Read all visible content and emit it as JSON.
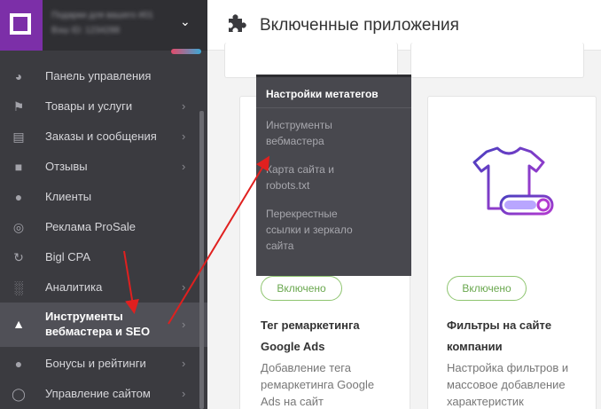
{
  "account": {
    "line1": "Подарки для вашего #01",
    "line2": "Вэш ID: 1234288"
  },
  "sidebar": {
    "items": [
      {
        "icon": "gauge-icon",
        "label": "Панель управления",
        "has_submenu": false
      },
      {
        "icon": "tag-icon",
        "label": "Товары и услуги",
        "has_submenu": true
      },
      {
        "icon": "cart-icon",
        "label": "Заказы и сообщения",
        "has_submenu": true
      },
      {
        "icon": "comment-icon",
        "label": "Отзывы",
        "has_submenu": true
      },
      {
        "icon": "users-icon",
        "label": "Клиенты",
        "has_submenu": false
      },
      {
        "icon": "target-icon",
        "label": "Реклама ProSale",
        "has_submenu": false
      },
      {
        "icon": "refresh-icon",
        "label": "Bigl CPA",
        "has_submenu": false
      },
      {
        "icon": "bar-chart-icon",
        "label": "Аналитика",
        "has_submenu": true
      },
      {
        "icon": "megaphone-icon",
        "label_line1": "Инструменты",
        "label_line2": "вебмастера и SEO",
        "has_submenu": true,
        "active": true
      },
      {
        "icon": "bonus-icon",
        "label": "Бонусы и рейтинги",
        "has_submenu": true
      },
      {
        "icon": "globe-icon",
        "label": "Управление сайтом",
        "has_submenu": true
      }
    ]
  },
  "header": {
    "icon": "puzzle-icon",
    "title": "Включенные приложения"
  },
  "dropdown": {
    "title": "Настройки метатегов",
    "items": [
      {
        "line1": "Инструменты",
        "line2": "вебмастера"
      },
      {
        "line1": "Карта сайта и",
        "line2": "robots.txt"
      },
      {
        "line1": "Перекрестные",
        "line2": "ссылки и зеркало",
        "line3": "сайта"
      }
    ]
  },
  "cards": [
    {
      "status": "Включено",
      "title_line1": "Тег ремаркетинга",
      "title_line2": "Google Ads",
      "desc_line1": "Добавление тега",
      "desc_line2": "ремаркетинга Google",
      "desc_line3": "Ads на сайт"
    },
    {
      "icon": "tshirt-filter-icon",
      "status": "Включено",
      "title_line1": "Фильтры на сайте",
      "title_line2": "компании",
      "desc_line1": "Настройка фильтров и",
      "desc_line2": "массовое добавление",
      "desc_line3": "характеристик"
    }
  ],
  "colors": {
    "sidebar_bg": "#3b3b40",
    "brand_purple": "#7c2fa8",
    "status_green": "#6aa84f",
    "annotation_red": "#e0201f"
  }
}
